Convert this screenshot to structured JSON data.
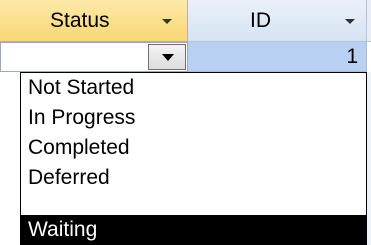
{
  "columns": [
    {
      "label": "Status"
    },
    {
      "label": "ID"
    }
  ],
  "edit_row": {
    "status_value": "",
    "id_value": "1"
  },
  "dropdown": {
    "options": [
      "Not Started",
      "In Progress",
      "Completed",
      "Deferred",
      "Waiting"
    ],
    "highlighted": "Waiting"
  },
  "colors": {
    "status_header": "#f7d774",
    "id_header": "#d6e3f2",
    "id_cell": "#b8d1f3",
    "highlight_bg": "#000000",
    "highlight_fg": "#ffffff"
  },
  "icons": [
    "dropdown-arrow-icon"
  ]
}
